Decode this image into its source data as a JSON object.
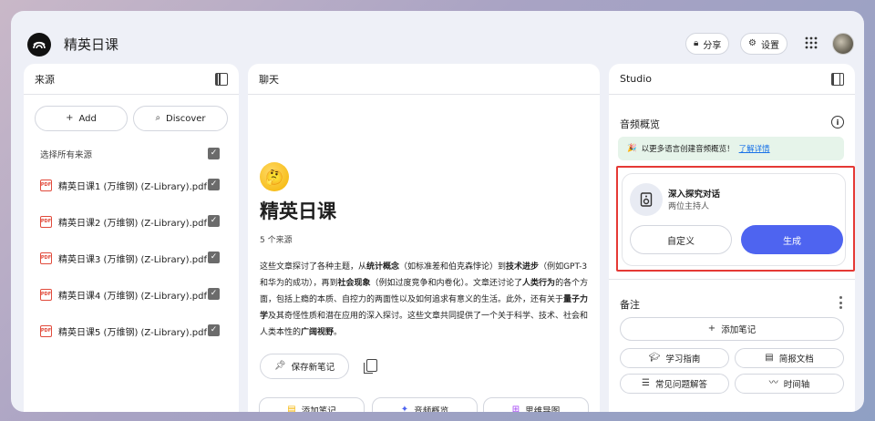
{
  "app": {
    "title": "精英日课"
  },
  "topbar": {
    "share_label": "分享",
    "settings_label": "设置"
  },
  "sources": {
    "header": "来源",
    "add_label": "Add",
    "discover_label": "Discover",
    "select_all_label": "选择所有来源",
    "items": [
      {
        "name": "精英日课1 (万维钢) (Z-Library).pdf",
        "checked": true
      },
      {
        "name": "精英日课2 (万维钢) (Z-Library).pdf",
        "checked": true
      },
      {
        "name": "精英日课3 (万维钢) (Z-Library).pdf",
        "checked": true
      },
      {
        "name": "精英日课4 (万维钢) (Z-Library).pdf",
        "checked": true
      },
      {
        "name": "精英日课5 (万维钢) (Z-Library).pdf",
        "checked": true
      }
    ]
  },
  "chat": {
    "header": "聊天",
    "emoji": "🤔",
    "title": "精英日课",
    "source_count": "5 个来源",
    "summary_parts": [
      {
        "t": "这些文章探讨了各种主题，从",
        "b": false
      },
      {
        "t": "统计概念",
        "b": true
      },
      {
        "t": "（如标准差和伯克森悖论）到",
        "b": false
      },
      {
        "t": "技术进步",
        "b": true
      },
      {
        "t": "（例如GPT-3和华为的成功），再到",
        "b": false
      },
      {
        "t": "社会现象",
        "b": true
      },
      {
        "t": "（例如过度竞争和内卷化）。文章还讨论了",
        "b": false
      },
      {
        "t": "人类行为",
        "b": true
      },
      {
        "t": "的各个方面，包括上瘾的本质、自控力的两面性以及如何追求有意义的生活。此外，还有关于",
        "b": false
      },
      {
        "t": "量子力学",
        "b": true
      },
      {
        "t": "及其奇怪性质和潜在应用的深入探讨。这些文章共同提供了一个关于科学、技术、社会和人类本性的",
        "b": false
      },
      {
        "t": "广阔视野",
        "b": true
      },
      {
        "t": "。",
        "b": false
      }
    ],
    "save_note_label": "保存新笔记",
    "chips": [
      "添加笔记",
      "音频概览",
      "思维导图"
    ]
  },
  "studio": {
    "header": "Studio",
    "audio_section": "音频概览",
    "banner_text": "以更多语言创建音频概览！",
    "banner_link": "了解详情",
    "card_title": "深入探究对话",
    "card_subtitle": "两位主持人",
    "customize_label": "自定义",
    "generate_label": "生成",
    "notes_section": "备注",
    "add_note_label": "添加笔记",
    "note_chips": [
      "学习指南",
      "简报文档",
      "常见问题解答",
      "时间轴"
    ]
  },
  "colors": {
    "accent": "#4e64f0",
    "highlight_border": "#e53935",
    "banner_bg": "#e6f4ea"
  }
}
